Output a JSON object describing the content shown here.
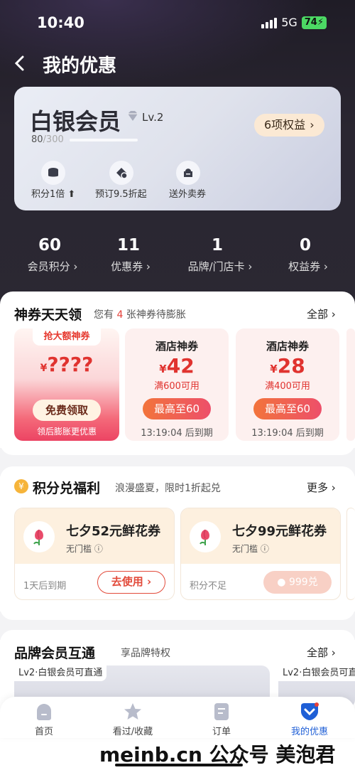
{
  "status": {
    "time": "10:40",
    "network": "5G",
    "battery": "74"
  },
  "header": {
    "title": "我的优惠"
  },
  "member": {
    "level_name": "白银会员",
    "level": "Lv.2",
    "points_now": "80",
    "points_total": "/300",
    "benefits_btn": "6项权益",
    "progress": 0.27,
    "benefits": [
      {
        "icon": "coins-icon",
        "label": "积分1倍"
      },
      {
        "icon": "discount-icon",
        "label": "预订9.5折起"
      },
      {
        "icon": "takeout-icon",
        "label": "送外卖券"
      }
    ]
  },
  "stats": [
    {
      "value": "60",
      "label": "会员积分"
    },
    {
      "value": "11",
      "label": "优惠券"
    },
    {
      "value": "1",
      "label": "品牌/门店卡"
    },
    {
      "value": "0",
      "label": "权益券"
    }
  ],
  "coupons": {
    "title": "神券天天领",
    "sub_pre": "您有",
    "sub_count": "4",
    "sub_post": "张神券待膨胀",
    "more": "全部",
    "big": {
      "tag": "抢大额神券",
      "amount": "????",
      "currency": "¥",
      "button": "免费领取",
      "note": "领后膨胀更优惠"
    },
    "items": [
      {
        "name": "酒店神券",
        "currency": "¥",
        "amount": "42",
        "cond": "满600可用",
        "button": "最高至60",
        "timer": "13:19:04",
        "timer_suffix": "后到期"
      },
      {
        "name": "酒店神券",
        "currency": "¥",
        "amount": "28",
        "cond": "满400可用",
        "button": "最高至60",
        "timer": "13:19:04",
        "timer_suffix": "后到期"
      }
    ]
  },
  "points": {
    "title": "积分兑福利",
    "sub": "浪漫盛夏，限时1折起兑",
    "more": "更多",
    "coin": "¥",
    "items": [
      {
        "name": "七夕52元鲜花券",
        "threshold": "无门槛",
        "footer": "1天后到期",
        "button": "去使用"
      },
      {
        "name": "七夕99元鲜花券",
        "threshold": "无门槛",
        "footer": "积分不足",
        "button": "999兑"
      }
    ]
  },
  "brand": {
    "title": "品牌会员互通",
    "sub": "享品牌特权",
    "more": "全部",
    "cards": [
      "Lv2·白银会员可直通",
      "Lv2·白银会员可直"
    ]
  },
  "tabs": [
    {
      "icon": "home-icon",
      "label": "首页"
    },
    {
      "icon": "star-icon",
      "label": "看过/收藏"
    },
    {
      "icon": "order-icon",
      "label": "订单"
    },
    {
      "icon": "coupon-icon",
      "label": "我的优惠"
    }
  ],
  "watermark": "meinb.cn 公众号 美泡君",
  "colors": {
    "accent": "#e0332f",
    "tab_active": "#1f5fd6"
  }
}
